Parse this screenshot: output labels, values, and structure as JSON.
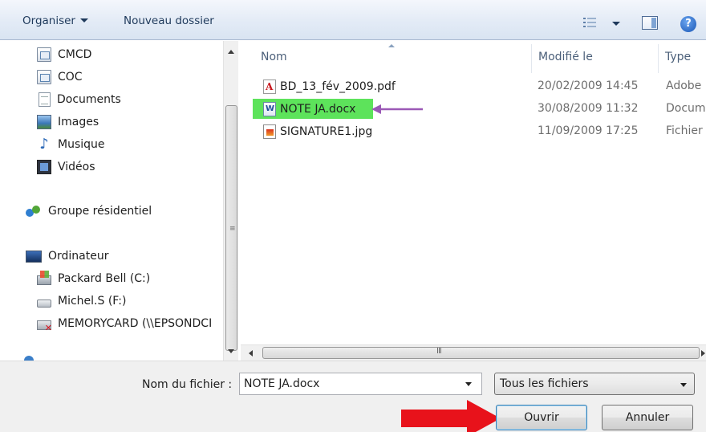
{
  "toolbar": {
    "organiser_label": "Organiser",
    "new_folder_label": "Nouveau dossier"
  },
  "nav": {
    "items": [
      {
        "label": "CMCD",
        "icon": "library-icon"
      },
      {
        "label": "COC",
        "icon": "library-icon"
      },
      {
        "label": "Documents",
        "icon": "documents-icon"
      },
      {
        "label": "Images",
        "icon": "images-icon"
      },
      {
        "label": "Musique",
        "icon": "music-icon"
      },
      {
        "label": "Vidéos",
        "icon": "videos-icon"
      },
      {
        "label": "Groupe résidentiel",
        "icon": "homegroup-icon"
      },
      {
        "label": "Ordinateur",
        "icon": "computer-icon"
      },
      {
        "label": "Packard Bell (C:)",
        "icon": "system-drive-icon"
      },
      {
        "label": "Michel.S (F:)",
        "icon": "removable-drive-icon"
      },
      {
        "label": "MEMORYCARD (\\\\EPSONDCI",
        "icon": "disconnected-drive-icon"
      }
    ]
  },
  "files": {
    "columns": [
      "Nom",
      "Modifié le",
      "Type"
    ],
    "rows": [
      {
        "name": "BD_13_fév_2009.pdf",
        "modified": "20/02/2009 14:45",
        "type": "Adobe",
        "icon": "pdf-file-icon"
      },
      {
        "name": "NOTE JA.docx",
        "modified": "30/08/2009 11:32",
        "type": "Docum",
        "icon": "word-file-icon"
      },
      {
        "name": "SIGNATURE1.jpg",
        "modified": "11/09/2009 17:25",
        "type": "Fichier",
        "icon": "jpg-file-icon"
      }
    ],
    "highlight_color": "#5de35b",
    "annotation_arrow_color": "#9b59b6"
  },
  "bottom": {
    "filename_label": "Nom du fichier :",
    "filename_value": "NOTE JA.docx",
    "filter_value": "Tous les fichiers",
    "open_label": "Ouvrir",
    "cancel_label": "Annuler",
    "annotation_arrow_color": "#e8121b"
  }
}
